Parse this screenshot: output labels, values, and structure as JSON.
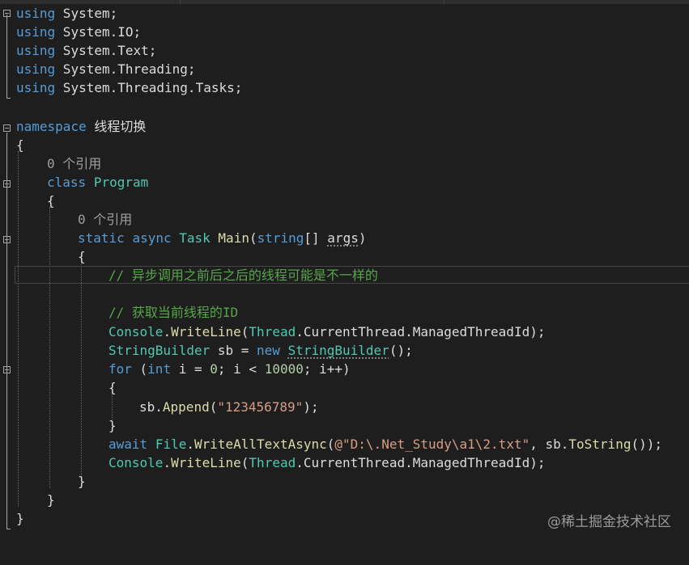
{
  "editor": {
    "lines": {
      "l1": {
        "kw": "using",
        "rest": " System;"
      },
      "l2": {
        "kw": "using",
        "rest": " System.IO;"
      },
      "l3": {
        "kw": "using",
        "rest": " System.Text;"
      },
      "l4": {
        "kw": "using",
        "rest": " System.Threading;"
      },
      "l5": {
        "kw": "using",
        "rest": " System.Threading.Tasks;"
      },
      "l7": {
        "kw": "namespace",
        "name": " 线程切换"
      },
      "l8": {
        "text": "{"
      },
      "l9": {
        "codelens": "0 个引用"
      },
      "l10": {
        "kw": "class",
        "type": "Program"
      },
      "l11": {
        "text": "{"
      },
      "l12": {
        "codelens": "0 个引用"
      },
      "l13": {
        "kw1": "static",
        "kw2": "async",
        "type": "Task",
        "method": "Main",
        "p1": "(",
        "kw3": "string",
        "p2": "[] ",
        "arg": "args",
        "p3": ")"
      },
      "l14": {
        "text": "{"
      },
      "l15": {
        "comment": "// 异步调用之前后之后的线程可能是不一样的"
      },
      "l17": {
        "comment": "// 获取当前线程的ID"
      },
      "l18": {
        "t1": "Console",
        "d1": ".",
        "m1": "WriteLine",
        "p1": "(",
        "t2": "Thread",
        "d2": ".CurrentThread.ManagedThreadId);"
      },
      "l19": {
        "t1": "StringBuilder",
        "p1": " sb = ",
        "kw": "new",
        "sp": " ",
        "t2": "StringBuilder",
        "p2": "();"
      },
      "l20": {
        "kw1": "for",
        "p1": " (",
        "kw2": "int",
        "p2": " i = ",
        "n1": "0",
        "p3": "; i < ",
        "n2": "10000",
        "p4": "; i++)"
      },
      "l21": {
        "text": "{"
      },
      "l22": {
        "v": "sb",
        "d": ".",
        "m": "Append",
        "p1": "(",
        "s": "\"123456789\"",
        "p2": ");"
      },
      "l23": {
        "text": "}"
      },
      "l24": {
        "kw": "await",
        "sp": " ",
        "t": "File",
        "d": ".",
        "m": "WriteAllTextAsync",
        "p1": "(",
        "s": "@\"D:\\.Net_Study\\a1\\2.txt\"",
        "p2": ", ",
        "v": "sb",
        "d2": ".",
        "m2": "ToString",
        "p3": "());"
      },
      "l25": {
        "t1": "Console",
        "d1": ".",
        "m1": "WriteLine",
        "p1": "(",
        "t2": "Thread",
        "d2": ".CurrentThread.ManagedThreadId);"
      },
      "l26": {
        "text": "}"
      },
      "l27": {
        "text": "}"
      },
      "l28": {
        "text": "}"
      }
    }
  },
  "watermark": "@稀土掘金技术社区",
  "colors": {
    "background": "#1e1e1e",
    "keyword": "#569cd6",
    "type": "#4ec9b0",
    "method": "#dcdcaa",
    "string": "#d69d85",
    "comment": "#57a64a",
    "number": "#b5cea8"
  }
}
